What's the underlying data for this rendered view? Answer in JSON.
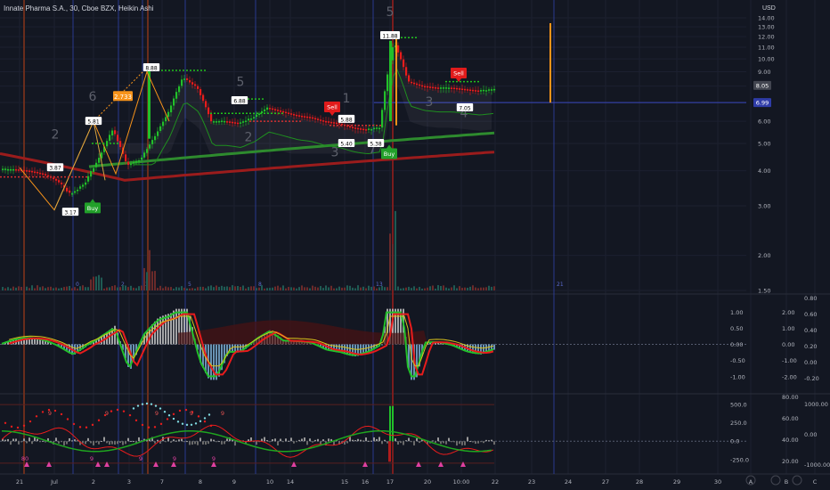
{
  "header": {
    "symbol_line": "Innate Pharma S.A., 30, Cboe BZX, Heikin Ashi",
    "currency": "USD"
  },
  "colors": {
    "background": "#131722",
    "grid": "#1c2030",
    "axis_text": "#b2b5be",
    "up": "#26a69a",
    "down": "#ef5350",
    "bright_up": "#22c02a",
    "bright_down": "#e81c1c",
    "orange": "#f7931a",
    "blue_line": "#2f3c9e",
    "green_line": "#2e8b2e",
    "dotted_green": "#21c21b",
    "wave_label": "#5d606b",
    "price_tag": "#ffffff"
  },
  "chart_data": [
    {
      "type": "candlestick",
      "title": "Innate Pharma S.A., 30, Cboe BZX, Heikin Ashi",
      "ylim": [
        1.25,
        14.4
      ],
      "y_ticks": [
        "14.00",
        "13.00",
        "12.00",
        "11.00",
        "10.00",
        "9.00",
        "8.00",
        "7.00",
        "6.00",
        "5.00",
        "4.00",
        "3.00",
        "2.00",
        "1.50"
      ],
      "x_ticks": [
        "21",
        "Jul",
        "2",
        "3",
        "7",
        "8",
        "9",
        "10",
        "14",
        "15",
        "16",
        "17",
        "20",
        "10:00",
        "22",
        "23",
        "24",
        "27",
        "28",
        "29",
        "30",
        "A",
        "B",
        "C"
      ],
      "price_tags": [
        {
          "value": 8.05,
          "label": "8.05",
          "style": "grey"
        },
        {
          "value": 6.99,
          "label": "6.99",
          "style": "blue"
        }
      ],
      "price_labels": [
        {
          "date": "21",
          "value": 4.1,
          "label": "3.87"
        },
        {
          "date": "Jul",
          "value": 2.85,
          "label": "3.17"
        },
        {
          "date": "2",
          "value": 6.0,
          "label": "5.81"
        },
        {
          "date": "3",
          "value": 9.3,
          "label": "8.88"
        },
        {
          "date": "9",
          "value": 7.1,
          "label": "6.88"
        },
        {
          "date": "15",
          "value": 6.1,
          "label": "5.88"
        },
        {
          "date": "15",
          "value": 5.0,
          "label": "5.40"
        },
        {
          "date": "16",
          "value": 5.0,
          "label": "5.38"
        },
        {
          "date": "17",
          "value": 12.1,
          "label": "11.88"
        },
        {
          "date": "20",
          "value": 6.7,
          "label": "7.05"
        }
      ],
      "signals": [
        {
          "label": "Buy",
          "date": "Jul",
          "value": 2.95,
          "kind": "buy"
        },
        {
          "label": "Sell",
          "date": "15",
          "value": 6.75,
          "kind": "sell"
        },
        {
          "label": "Buy",
          "date": "17",
          "value": 4.6,
          "kind": "buy"
        },
        {
          "label": "Sell",
          "date": "20",
          "value": 8.9,
          "kind": "sell"
        }
      ],
      "callouts": [
        {
          "label": "2.733",
          "date": "3",
          "value": 7.35
        }
      ],
      "wave_labels": [
        "2",
        "6",
        "5",
        "2",
        "3",
        "1",
        "7",
        "5",
        "3",
        "4"
      ],
      "vline_labels": [
        "0",
        "2",
        "3",
        "5",
        "8",
        "13",
        "21"
      ],
      "series": {
        "price_hint": [
          4.05,
          4.05,
          4.0,
          3.9,
          3.7,
          3.3,
          3.6,
          4.4,
          5.6,
          4.2,
          4.4,
          5.3,
          6.5,
          8.6,
          7.9,
          6.0,
          6.0,
          5.9,
          6.2,
          6.7,
          6.5,
          6.3,
          6.2,
          6.0,
          5.9,
          5.7,
          5.6,
          5.7,
          11.5,
          8.3,
          8.0,
          7.9,
          7.9,
          7.8,
          7.7,
          7.8
        ]
      }
    },
    {
      "type": "oscillator",
      "y_ticks_left": [
        "1.00",
        "0.50",
        "0.00",
        "-0.50",
        "-1.00"
      ],
      "y_ticks_mid": [
        "2.00",
        "1.00",
        "0.00",
        "-1.00",
        "-2.00"
      ],
      "y_ticks_right": [
        "0.80",
        "0.60",
        "0.40",
        "0.20",
        "0.00",
        "-0.20"
      ],
      "ylim": [
        -1.3,
        1.3
      ]
    },
    {
      "type": "oscillator",
      "y_ticks_left": [
        "500.0",
        "250.0",
        "0.0",
        "-250.0"
      ],
      "y_ticks_mid": [
        "80.00",
        "60.00",
        "40.00",
        "20.00"
      ],
      "y_ticks_right": [
        "1000.00",
        "0.00",
        "-1000.00"
      ],
      "ylim": [
        -350,
        600
      ],
      "markers": [
        "80",
        "9",
        "9",
        "9",
        "9",
        "9",
        "9",
        "9",
        "9",
        "9"
      ]
    }
  ]
}
